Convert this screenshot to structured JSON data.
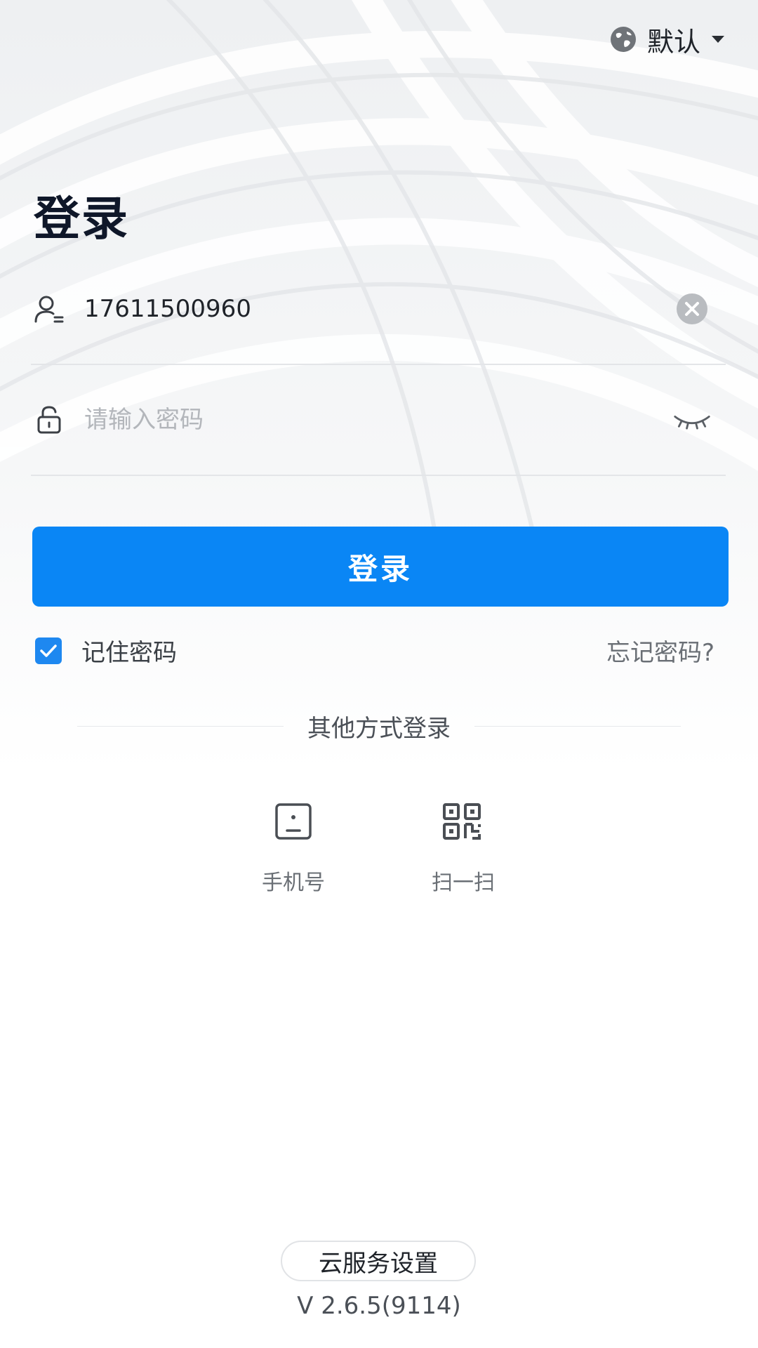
{
  "header": {
    "language_label": "默认"
  },
  "page": {
    "title": "登录"
  },
  "form": {
    "username_value": "17611500960",
    "password_placeholder": "请输入密码",
    "login_button": "登录",
    "remember_label": "记住密码",
    "remember_checked": true,
    "forgot_label": "忘记密码?"
  },
  "other": {
    "divider_text": "其他方式登录",
    "options": [
      {
        "label": "手机号",
        "icon": "phone-icon"
      },
      {
        "label": "扫一扫",
        "icon": "qr-code-icon"
      }
    ]
  },
  "footer": {
    "cloud_settings": "云服务设置",
    "version": "V 2.6.5(9114)"
  },
  "colors": {
    "primary": "#0a86f5",
    "checkbox": "#1e88f0",
    "title": "#0f1729"
  }
}
